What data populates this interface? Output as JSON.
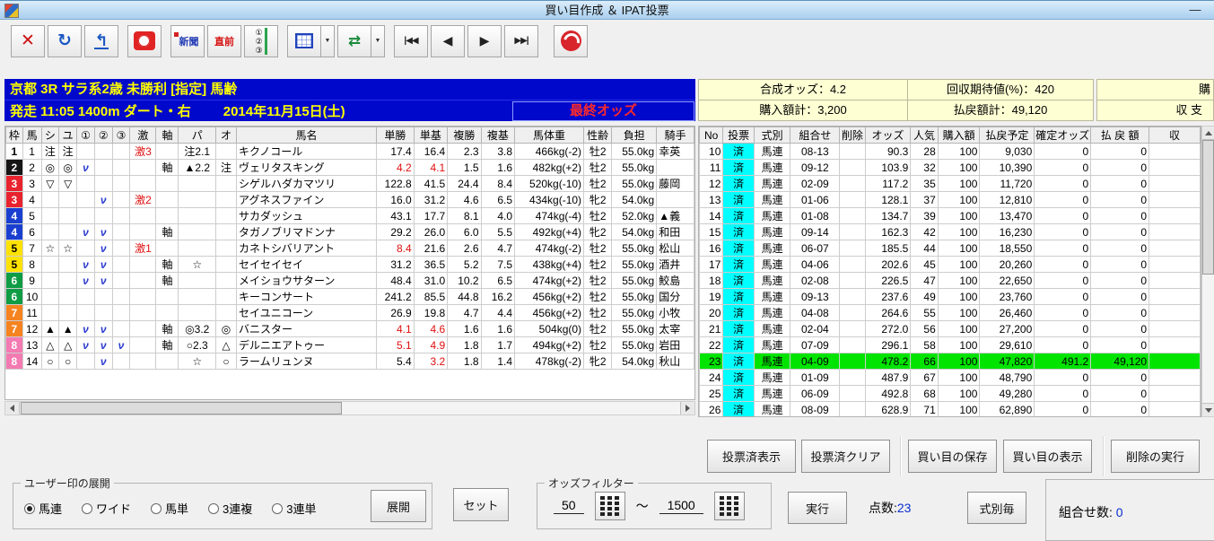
{
  "title_bar": {
    "title": "買い目作成 ＆ IPAT投票",
    "minimize": "—"
  },
  "toolbar": {
    "newspaper": "新聞",
    "last_minute": "直前",
    "mark_list": "①②③",
    "icons": {
      "close": "✕",
      "refresh": "↻",
      "undo": "↰",
      "transfer": "⇄",
      "dropdown": "▼",
      "first": "|◀◀",
      "prev": "◀",
      "next": "▶",
      "last": "▶▶|"
    }
  },
  "race_header": {
    "line1": "京都 3R サラ系2歳 未勝利 [指定] 馬齢",
    "start_info": "発走 11:05 1400m ダート・右",
    "date": "2014年11月15日(土)",
    "odds_status": "最終オッズ"
  },
  "summary": {
    "synthetic_odds": "合成オッズ：4.2",
    "expected_return": "回収期待値(%)：420",
    "purchase_total": "購入額計：3,200",
    "payout_total": "払戻額計：49,120",
    "cut_top": "購",
    "cut_bottom": "収 支"
  },
  "waku_colors": {
    "1": [
      "#ffffff",
      "#000000"
    ],
    "2": [
      "#151515",
      "#ffffff"
    ],
    "3": [
      "#e8232e",
      "#ffffff"
    ],
    "4": [
      "#1a3fd0",
      "#ffffff"
    ],
    "5": [
      "#ffe200",
      "#000000"
    ],
    "6": [
      "#0e9c44",
      "#ffffff"
    ],
    "7": [
      "#f5831f",
      "#ffffff"
    ],
    "8": [
      "#f47ab2",
      "#ffffff"
    ]
  },
  "horse_table": {
    "headers": [
      "枠",
      "馬",
      "シ",
      "ユ",
      "①",
      "②",
      "③",
      "激",
      "軸",
      "パ",
      "オ",
      "馬名",
      "単勝",
      "単基",
      "複勝",
      "複基",
      "馬体重",
      "性齢",
      "負担",
      "騎手"
    ],
    "rows": [
      {
        "waku": 1,
        "uma": 1,
        "shi": "注",
        "yu": "注",
        "c1": "",
        "c2": "",
        "c3": "",
        "geki": "激3",
        "jiku": "",
        "pa": "注2.1",
        "o": "",
        "name": "キクノコール",
        "tan": "17.4",
        "tanki": "16.4",
        "fuku": "2.3",
        "fukuki": "3.8",
        "weight": "466kg(-2)",
        "sexage": "牡2",
        "futan": "55.0kg",
        "jockey": "幸英"
      },
      {
        "waku": 2,
        "uma": 2,
        "shi": "◎",
        "yu": "◎",
        "c1": "ν",
        "c2": "",
        "c3": "",
        "geki": "",
        "jiku": "軸",
        "pa": "▲2.2",
        "o": "注",
        "name": "ヴェリタスキング",
        "tan": "4.2",
        "tanki": "4.1",
        "fuku": "1.5",
        "fukuki": "1.6",
        "tan_red": true,
        "tanki_red": true,
        "weight": "482kg(+2)",
        "sexage": "牡2",
        "futan": "55.0kg",
        "jockey": ""
      },
      {
        "waku": 3,
        "uma": 3,
        "shi": "▽",
        "yu": "▽",
        "c1": "",
        "c2": "",
        "c3": "",
        "geki": "",
        "jiku": "",
        "pa": "",
        "o": "",
        "name": "シゲルハダカマツリ",
        "tan": "122.8",
        "tanki": "41.5",
        "fuku": "24.4",
        "fukuki": "8.4",
        "weight": "520kg(-10)",
        "sexage": "牡2",
        "futan": "55.0kg",
        "jockey": "藤岡"
      },
      {
        "waku": 3,
        "uma": 4,
        "shi": "",
        "yu": "",
        "c1": "",
        "c2": "ν",
        "c3": "",
        "geki": "激2",
        "jiku": "",
        "pa": "",
        "o": "",
        "name": "アグネスファイン",
        "tan": "16.0",
        "tanki": "31.2",
        "fuku": "4.6",
        "fukuki": "6.5",
        "weight": "434kg(-10)",
        "sexage": "牝2",
        "futan": "54.0kg",
        "jockey": ""
      },
      {
        "waku": 4,
        "uma": 5,
        "shi": "",
        "yu": "",
        "c1": "",
        "c2": "",
        "c3": "",
        "geki": "",
        "jiku": "",
        "pa": "",
        "o": "",
        "name": "サカダッシュ",
        "tan": "43.1",
        "tanki": "17.7",
        "fuku": "8.1",
        "fukuki": "4.0",
        "weight": "474kg(-4)",
        "sexage": "牡2",
        "futan": "52.0kg",
        "jockey": "▲義"
      },
      {
        "waku": 4,
        "uma": 6,
        "shi": "",
        "yu": "",
        "c1": "ν",
        "c2": "ν",
        "c3": "",
        "geki": "",
        "jiku": "軸",
        "pa": "",
        "o": "",
        "name": "タガノブリマドンナ",
        "tan": "29.2",
        "tanki": "26.0",
        "fuku": "6.0",
        "fukuki": "5.5",
        "weight": "492kg(+4)",
        "sexage": "牝2",
        "futan": "54.0kg",
        "jockey": "和田"
      },
      {
        "waku": 5,
        "uma": 7,
        "shi": "☆",
        "yu": "☆",
        "c1": "",
        "c2": "ν",
        "c3": "",
        "geki": "激1",
        "jiku": "",
        "pa": "",
        "o": "",
        "name": "カネトシバリアント",
        "tan": "8.4",
        "tanki": "21.6",
        "fuku": "2.6",
        "fukuki": "4.7",
        "tan_red": true,
        "weight": "474kg(-2)",
        "sexage": "牡2",
        "futan": "55.0kg",
        "jockey": "松山"
      },
      {
        "waku": 5,
        "uma": 8,
        "shi": "",
        "yu": "",
        "c1": "ν",
        "c2": "ν",
        "c3": "",
        "geki": "",
        "jiku": "軸",
        "pa": "☆",
        "o": "",
        "name": "セイセイセイ",
        "tan": "31.2",
        "tanki": "36.5",
        "fuku": "5.2",
        "fukuki": "7.5",
        "weight": "438kg(+4)",
        "sexage": "牡2",
        "futan": "55.0kg",
        "jockey": "酒井"
      },
      {
        "waku": 6,
        "uma": 9,
        "shi": "",
        "yu": "",
        "c1": "ν",
        "c2": "ν",
        "c3": "",
        "geki": "",
        "jiku": "軸",
        "pa": "",
        "o": "",
        "name": "メイショウサターン",
        "tan": "48.4",
        "tanki": "31.0",
        "fuku": "10.2",
        "fukuki": "6.5",
        "weight": "474kg(+2)",
        "sexage": "牡2",
        "futan": "55.0kg",
        "jockey": "鮫島"
      },
      {
        "waku": 6,
        "uma": 10,
        "shi": "",
        "yu": "",
        "c1": "",
        "c2": "",
        "c3": "",
        "geki": "",
        "jiku": "",
        "pa": "",
        "o": "",
        "name": "キーコンサート",
        "tan": "241.2",
        "tanki": "85.5",
        "fuku": "44.8",
        "fukuki": "16.2",
        "weight": "456kg(+2)",
        "sexage": "牡2",
        "futan": "55.0kg",
        "jockey": "国分"
      },
      {
        "waku": 7,
        "uma": 11,
        "shi": "",
        "yu": "",
        "c1": "",
        "c2": "",
        "c3": "",
        "geki": "",
        "jiku": "",
        "pa": "",
        "o": "",
        "name": "セイユニコーン",
        "tan": "26.9",
        "tanki": "19.8",
        "fuku": "4.7",
        "fukuki": "4.4",
        "weight": "456kg(+2)",
        "sexage": "牡2",
        "futan": "55.0kg",
        "jockey": "小牧"
      },
      {
        "waku": 7,
        "uma": 12,
        "shi": "▲",
        "yu": "▲",
        "c1": "ν",
        "c2": "ν",
        "c3": "",
        "geki": "",
        "jiku": "軸",
        "pa": "◎3.2",
        "o": "◎",
        "name": "バニスター",
        "tan": "4.1",
        "tanki": "4.6",
        "fuku": "1.6",
        "fukuki": "1.6",
        "tan_red": true,
        "tanki_red": true,
        "weight": "504kg(0)",
        "sexage": "牡2",
        "futan": "55.0kg",
        "jockey": "太宰"
      },
      {
        "waku": 8,
        "uma": 13,
        "shi": "△",
        "yu": "△",
        "c1": "ν",
        "c2": "ν",
        "c3": "ν",
        "geki": "",
        "jiku": "軸",
        "pa": "○2.3",
        "o": "△",
        "name": "デルニエアトゥー",
        "tan": "5.1",
        "tanki": "4.9",
        "fuku": "1.8",
        "fukuki": "1.7",
        "tan_red": true,
        "tanki_red": true,
        "weight": "494kg(+2)",
        "sexage": "牡2",
        "futan": "55.0kg",
        "jockey": "岩田"
      },
      {
        "waku": 8,
        "uma": 14,
        "shi": "○",
        "yu": "○",
        "c1": "",
        "c2": "ν",
        "c3": "",
        "geki": "",
        "jiku": "",
        "pa": "☆",
        "o": "○",
        "name": "ラームリュンヌ",
        "tan": "5.4",
        "tanki": "3.2",
        "fuku": "1.8",
        "fukuki": "1.4",
        "tanki_red": true,
        "weight": "478kg(-2)",
        "sexage": "牝2",
        "futan": "54.0kg",
        "jockey": "秋山"
      }
    ]
  },
  "bet_table": {
    "headers": [
      "No",
      "投票",
      "式別",
      "組合せ",
      "削除",
      "オッズ",
      "人気",
      "購入額",
      "払戻予定",
      "確定オッズ",
      "払 戻 額",
      "収"
    ],
    "rows": [
      {
        "no": "10",
        "vote": "済",
        "type": "馬連",
        "combo": "08-13",
        "odds": "90.3",
        "pop": "28",
        "amount": "100",
        "expected": "9,030",
        "fixed": "0",
        "payout": "0",
        "highlight": false
      },
      {
        "no": "11",
        "vote": "済",
        "type": "馬連",
        "combo": "09-12",
        "odds": "103.9",
        "pop": "32",
        "amount": "100",
        "expected": "10,390",
        "fixed": "0",
        "payout": "0",
        "highlight": false
      },
      {
        "no": "12",
        "vote": "済",
        "type": "馬連",
        "combo": "02-09",
        "odds": "117.2",
        "pop": "35",
        "amount": "100",
        "expected": "11,720",
        "fixed": "0",
        "payout": "0",
        "highlight": false
      },
      {
        "no": "13",
        "vote": "済",
        "type": "馬連",
        "combo": "01-06",
        "odds": "128.1",
        "pop": "37",
        "amount": "100",
        "expected": "12,810",
        "fixed": "0",
        "payout": "0",
        "highlight": false
      },
      {
        "no": "14",
        "vote": "済",
        "type": "馬連",
        "combo": "01-08",
        "odds": "134.7",
        "pop": "39",
        "amount": "100",
        "expected": "13,470",
        "fixed": "0",
        "payout": "0",
        "highlight": false
      },
      {
        "no": "15",
        "vote": "済",
        "type": "馬連",
        "combo": "09-14",
        "odds": "162.3",
        "pop": "42",
        "amount": "100",
        "expected": "16,230",
        "fixed": "0",
        "payout": "0",
        "highlight": false
      },
      {
        "no": "16",
        "vote": "済",
        "type": "馬連",
        "combo": "06-07",
        "odds": "185.5",
        "pop": "44",
        "amount": "100",
        "expected": "18,550",
        "fixed": "0",
        "payout": "0",
        "highlight": false
      },
      {
        "no": "17",
        "vote": "済",
        "type": "馬連",
        "combo": "04-06",
        "odds": "202.6",
        "pop": "45",
        "amount": "100",
        "expected": "20,260",
        "fixed": "0",
        "payout": "0",
        "highlight": false
      },
      {
        "no": "18",
        "vote": "済",
        "type": "馬連",
        "combo": "02-08",
        "odds": "226.5",
        "pop": "47",
        "amount": "100",
        "expected": "22,650",
        "fixed": "0",
        "payout": "0",
        "highlight": false
      },
      {
        "no": "19",
        "vote": "済",
        "type": "馬連",
        "combo": "09-13",
        "odds": "237.6",
        "pop": "49",
        "amount": "100",
        "expected": "23,760",
        "fixed": "0",
        "payout": "0",
        "highlight": false
      },
      {
        "no": "20",
        "vote": "済",
        "type": "馬連",
        "combo": "04-08",
        "odds": "264.6",
        "pop": "55",
        "amount": "100",
        "expected": "26,460",
        "fixed": "0",
        "payout": "0",
        "highlight": false
      },
      {
        "no": "21",
        "vote": "済",
        "type": "馬連",
        "combo": "02-04",
        "odds": "272.0",
        "pop": "56",
        "amount": "100",
        "expected": "27,200",
        "fixed": "0",
        "payout": "0",
        "highlight": false
      },
      {
        "no": "22",
        "vote": "済",
        "type": "馬連",
        "combo": "07-09",
        "odds": "296.1",
        "pop": "58",
        "amount": "100",
        "expected": "29,610",
        "fixed": "0",
        "payout": "0",
        "highlight": false
      },
      {
        "no": "23",
        "vote": "済",
        "type": "馬連",
        "combo": "04-09",
        "odds": "478.2",
        "pop": "66",
        "amount": "100",
        "expected": "47,820",
        "fixed": "491.2",
        "payout": "49,120",
        "highlight": true
      },
      {
        "no": "24",
        "vote": "済",
        "type": "馬連",
        "combo": "01-09",
        "odds": "487.9",
        "pop": "67",
        "amount": "100",
        "expected": "48,790",
        "fixed": "0",
        "payout": "0",
        "highlight": false
      },
      {
        "no": "25",
        "vote": "済",
        "type": "馬連",
        "combo": "06-09",
        "odds": "492.8",
        "pop": "68",
        "amount": "100",
        "expected": "49,280",
        "fixed": "0",
        "payout": "0",
        "highlight": false
      },
      {
        "no": "26",
        "vote": "済",
        "type": "馬連",
        "combo": "08-09",
        "odds": "628.9",
        "pop": "71",
        "amount": "100",
        "expected": "62,890",
        "fixed": "0",
        "payout": "0",
        "highlight": false
      }
    ]
  },
  "action_buttons": [
    "投票済表示",
    "投票済クリア",
    "買い目の保存",
    "買い目の表示",
    "削除の実行"
  ],
  "user_mark": {
    "legend": "ユーザー印の展開",
    "options": [
      {
        "label": "馬連",
        "selected": true
      },
      {
        "label": "ワイド",
        "selected": false
      },
      {
        "label": "馬単",
        "selected": false
      },
      {
        "label": "3連複",
        "selected": false
      },
      {
        "label": "3連単",
        "selected": false
      }
    ],
    "expand": "展開",
    "set": "セット"
  },
  "odds_filter": {
    "legend": "オッズフィルター",
    "min": "50",
    "tilde": "～",
    "max": "1500",
    "execute": "実行",
    "count_label": "点数:",
    "count": "23",
    "per_type": "式別毎"
  },
  "combo_count": {
    "label": "組合せ数:",
    "value": "0"
  }
}
